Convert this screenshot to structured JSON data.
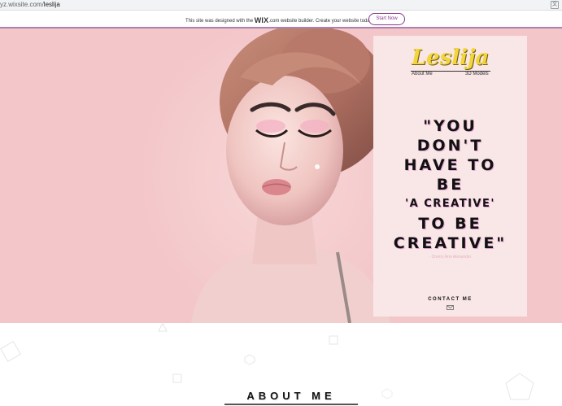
{
  "browser": {
    "url_visible": "yz.wixsite.com/",
    "url_path": "leslija",
    "translate_icon": "translate-icon"
  },
  "wix_banner": {
    "message_prefix": "This site was designed with the ",
    "logo_text": "WIX",
    "message_suffix": ".com website builder. Create your website today.",
    "cta_label": "Start Now"
  },
  "header": {
    "brand": "Leslija",
    "nav": [
      "About Me",
      "3D Models"
    ]
  },
  "quote": {
    "lines": [
      "\"YOU",
      "DON'T",
      "HAVE TO",
      "BE",
      "'A CREATIVE'",
      "TO BE",
      "CREATIVE\""
    ],
    "author": "- Cherry Ann Alexander"
  },
  "contact": {
    "label": "CONTACT ME",
    "icon": "envelope-icon"
  },
  "about_section": {
    "heading": "ABOUT ME"
  },
  "colors": {
    "hero_bg": "#f3c6c9",
    "panel_bg": "#f9e6e6",
    "brand_yellow": "#f2d53b",
    "wix_accent": "#8a3c8a"
  }
}
